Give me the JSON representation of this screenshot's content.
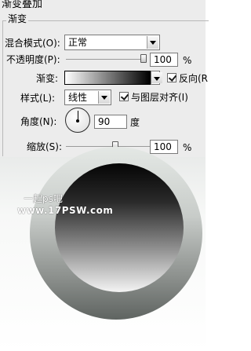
{
  "panel": {
    "title": "渐变叠加",
    "legend": "渐变",
    "blend_mode": {
      "label": "混合模式(O):",
      "value": "正常"
    },
    "opacity": {
      "label": "不透明度(P):",
      "value": "100",
      "unit": "%",
      "level_percent": 100
    },
    "gradient": {
      "label": "渐变:",
      "reverse_label": "反向(R",
      "reverse_checked": true
    },
    "style": {
      "label": "样式(L):",
      "value": "线性",
      "align_label": "与图层对齐(I)",
      "align_checked": true
    },
    "angle": {
      "label": "角度(N):",
      "value": "90",
      "unit": "度"
    },
    "scale": {
      "label": "缩放(S):",
      "value": "100",
      "unit": "%",
      "level_percent": 100
    }
  },
  "canvas": {
    "watermark_line1": "一起ps吧",
    "watermark_line2": "www.17PSW.com"
  }
}
